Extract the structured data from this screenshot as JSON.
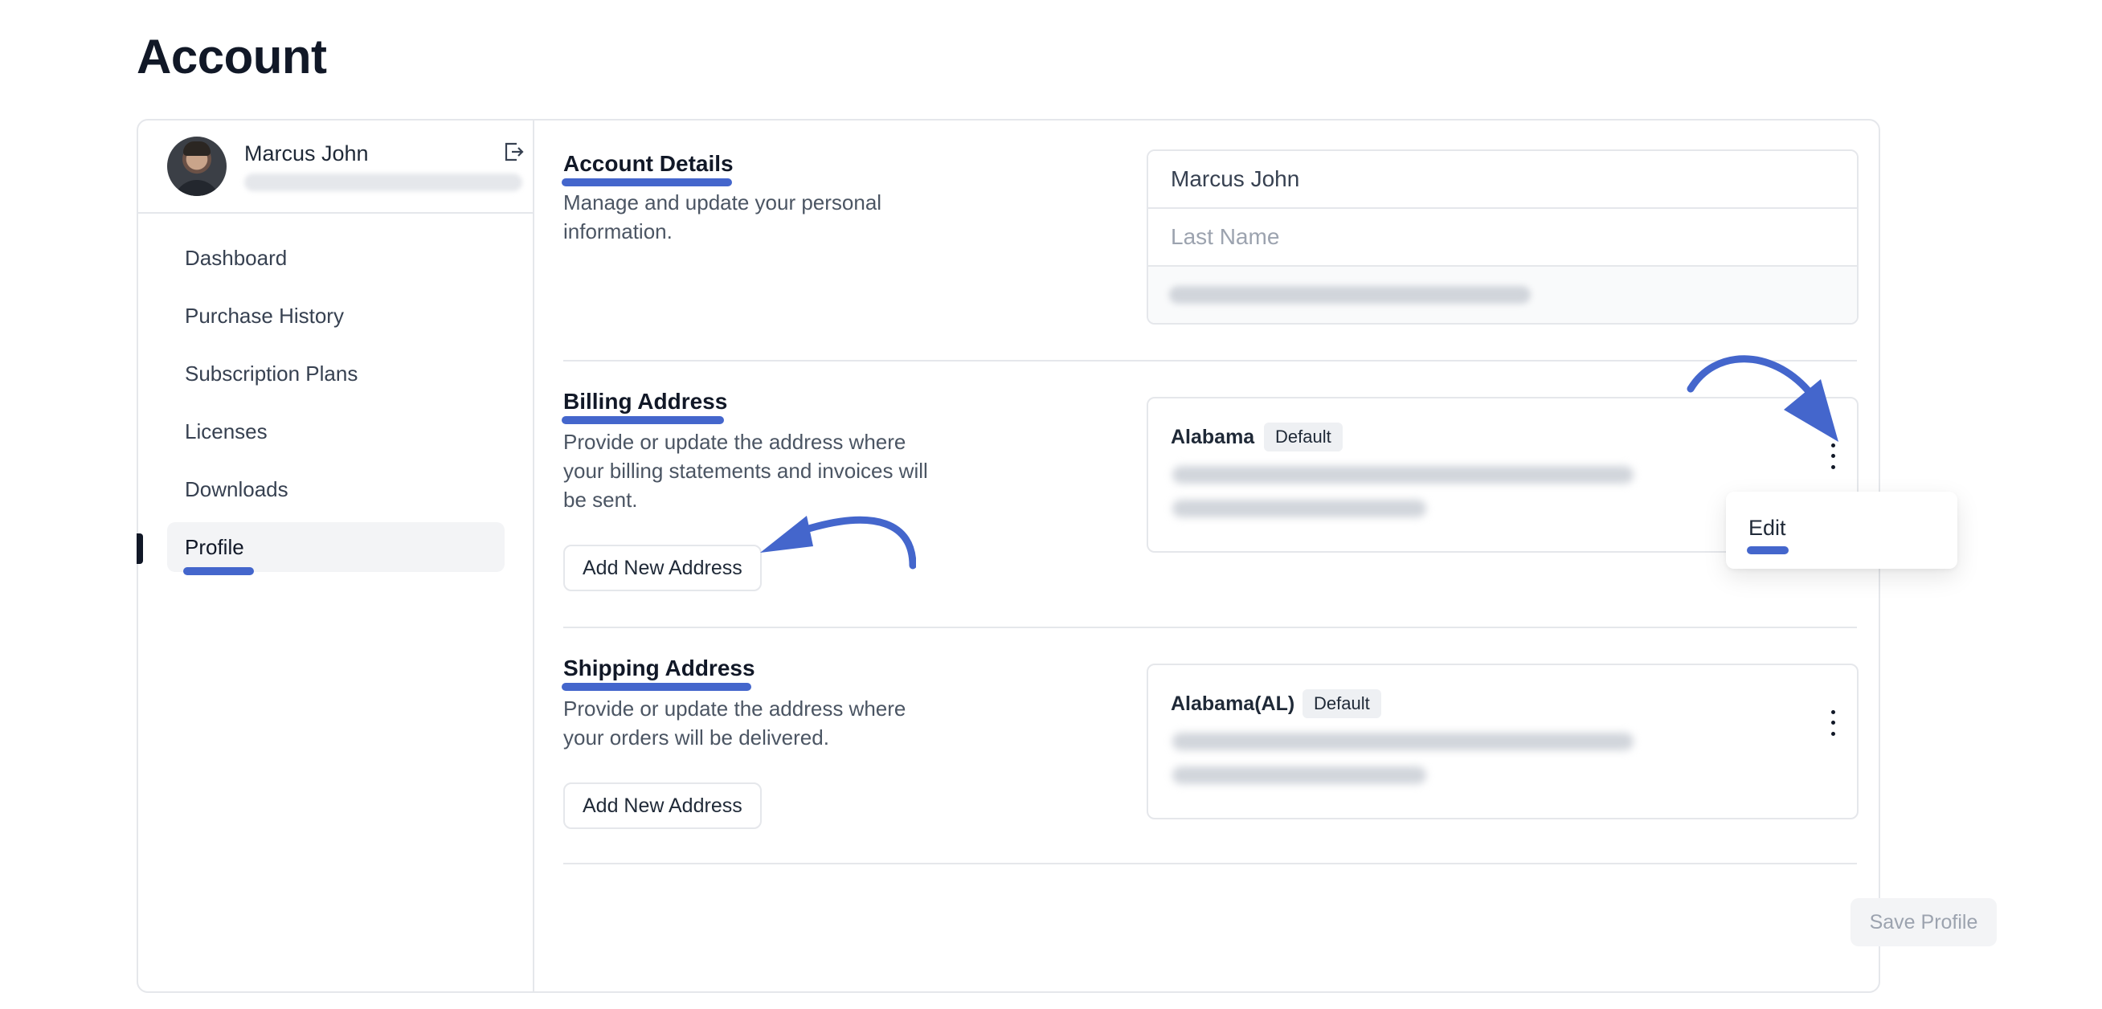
{
  "page": {
    "title": "Account"
  },
  "user": {
    "name": "Marcus John"
  },
  "sidebar": {
    "items": [
      {
        "label": "Dashboard"
      },
      {
        "label": "Purchase History"
      },
      {
        "label": "Subscription Plans"
      },
      {
        "label": "Licenses"
      },
      {
        "label": "Downloads"
      },
      {
        "label": "Profile",
        "active": true
      }
    ]
  },
  "account_details": {
    "title": "Account Details",
    "description": "Manage and update your personal information.",
    "first_name_value": "Marcus John",
    "last_name_placeholder": "Last Name"
  },
  "billing": {
    "title": "Billing Address",
    "description": "Provide or update the address where your billing statements and invoices will be sent.",
    "add_button": "Add New Address",
    "address": {
      "state": "Alabama",
      "badge": "Default"
    },
    "menu": {
      "edit_label": "Edit"
    }
  },
  "shipping": {
    "title": "Shipping Address",
    "description": "Provide or update the address where your orders will be delivered.",
    "add_button": "Add New Address",
    "address": {
      "state": "Alabama(AL)",
      "badge": "Default"
    }
  },
  "actions": {
    "save_label": "Save Profile"
  },
  "colors": {
    "highlight": "#4466cc",
    "text": "#1f2937",
    "border": "#e5e7eb"
  }
}
